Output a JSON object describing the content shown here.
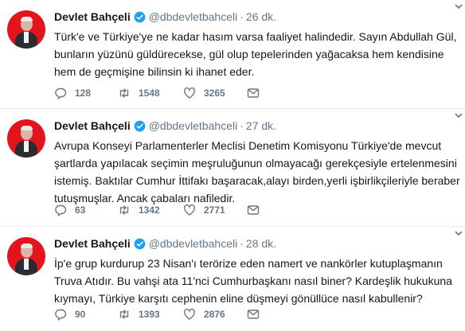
{
  "account": {
    "display_name": "Devlet Bahçeli",
    "handle": "@dbdevletbahceli"
  },
  "colors": {
    "text": "#14171a",
    "secondary": "#657786",
    "verified": "#1da1f2",
    "divider": "#e6ecf0",
    "avatar_bg": "#e3141b"
  },
  "icons": [
    "verified-badge-icon",
    "chevron-down-icon",
    "reply-icon",
    "retweet-icon",
    "like-icon",
    "direct-message-icon"
  ],
  "tweets": [
    {
      "time": "26 dk.",
      "lines": [
        "Türk'e ve Türkiye'ye ne kadar hasım varsa faaliyet halindedir. Sayın Abdullah Gül,",
        "bunların yüzünü güldürecekse, gül olup tepelerinden yağacaksa hem kendisine",
        "hem de geçmişine bilinsin ki ihanet eder."
      ],
      "replies": "128",
      "retweets": "1548",
      "likes": "3265"
    },
    {
      "time": "27 dk.",
      "lines": [
        "Avrupa Konseyi Parlamenterler Meclisi Denetim Komisyonu Türkiye'de mevcut",
        "şartlarda yapılacak seçimin meşruluğunun olmayacağı gerekçesiyle ertelenmesini",
        "istemiş. Baktılar Cumhur İttifakı başaracak,alayı birden,yerli işbirlikçileriyle beraber",
        "tutuşmuşlar. Ancak çabaları nafiledir."
      ],
      "replies": "63",
      "retweets": "1342",
      "likes": "2771"
    },
    {
      "time": "28 dk.",
      "lines": [
        "İp'e grup kurdurup 23 Nisan'ı terörize eden namert ve nankörler kutuplaşmanın",
        "Truva Atıdır. Bu vahşi ata 11'nci Cumhurbaşkanı nasıl biner? Kardeşlik hukukuna",
        "kıymayı, Türkiye karşıtı cephenin eline düşmeyi gönüllüce nasıl kabullenir?"
      ],
      "replies": "90",
      "retweets": "1393",
      "likes": "2876"
    }
  ]
}
